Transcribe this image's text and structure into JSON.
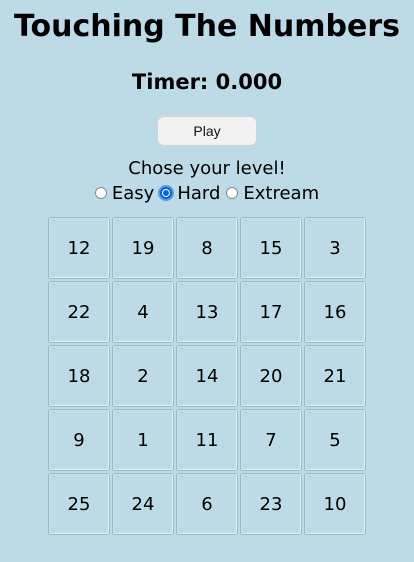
{
  "title": "Touching The Numbers",
  "timer": "Timer: 0.000",
  "play_label": "Play",
  "level_prompt": "Chose your level!",
  "levels": [
    {
      "label": "Easy",
      "checked": false
    },
    {
      "label": "Hard",
      "checked": true
    },
    {
      "label": "Extream",
      "checked": false
    }
  ],
  "grid": [
    [
      "12",
      "19",
      "8",
      "15",
      "3"
    ],
    [
      "22",
      "4",
      "13",
      "17",
      "16"
    ],
    [
      "18",
      "2",
      "14",
      "20",
      "21"
    ],
    [
      "9",
      "1",
      "11",
      "7",
      "5"
    ],
    [
      "25",
      "24",
      "6",
      "23",
      "10"
    ]
  ],
  "colors": {
    "background": "#bddbe6",
    "radio_accent": "#0a63d6"
  }
}
